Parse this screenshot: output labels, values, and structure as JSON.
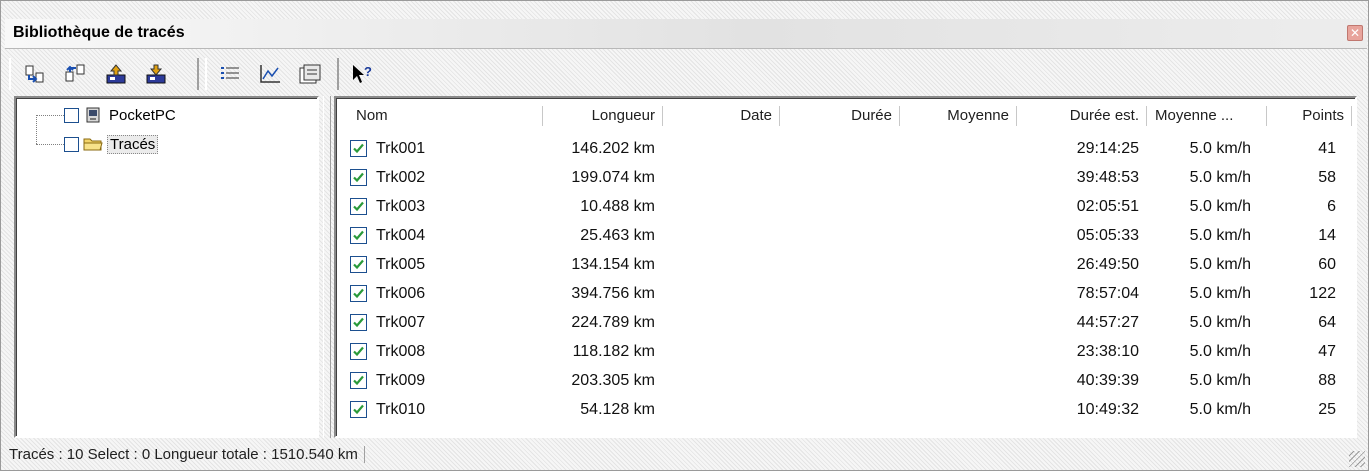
{
  "window": {
    "title": "Bibliothèque de tracés",
    "close_glyph": "✕"
  },
  "toolbar": {
    "buttons": [
      {
        "icon": "move-down-icon"
      },
      {
        "icon": "move-up-icon"
      },
      {
        "icon": "upload-icon"
      },
      {
        "icon": "download-icon"
      },
      {
        "icon": "list-view-icon"
      },
      {
        "icon": "chart-icon"
      },
      {
        "icon": "properties-icon"
      },
      {
        "icon": "help-pointer-icon"
      }
    ]
  },
  "tree": {
    "items": [
      {
        "label": "PocketPC",
        "icon": "device-icon"
      },
      {
        "label": "Tracés",
        "icon": "folder-icon"
      }
    ]
  },
  "list": {
    "columns": [
      "Nom",
      "Longueur",
      "Date",
      "Durée",
      "Moyenne",
      "Durée est.",
      "Moyenne ...",
      "Points"
    ],
    "rows": [
      {
        "name": "Trk001",
        "length": "146.202 km",
        "date": "",
        "duration": "",
        "average": "",
        "est_duration": "29:14:25",
        "est_average": "5.0 km/h",
        "points": "41",
        "checked": true
      },
      {
        "name": "Trk002",
        "length": "199.074 km",
        "date": "",
        "duration": "",
        "average": "",
        "est_duration": "39:48:53",
        "est_average": "5.0 km/h",
        "points": "58",
        "checked": true
      },
      {
        "name": "Trk003",
        "length": "10.488 km",
        "date": "",
        "duration": "",
        "average": "",
        "est_duration": "02:05:51",
        "est_average": "5.0 km/h",
        "points": "6",
        "checked": true
      },
      {
        "name": "Trk004",
        "length": "25.463 km",
        "date": "",
        "duration": "",
        "average": "",
        "est_duration": "05:05:33",
        "est_average": "5.0 km/h",
        "points": "14",
        "checked": true
      },
      {
        "name": "Trk005",
        "length": "134.154 km",
        "date": "",
        "duration": "",
        "average": "",
        "est_duration": "26:49:50",
        "est_average": "5.0 km/h",
        "points": "60",
        "checked": true
      },
      {
        "name": "Trk006",
        "length": "394.756 km",
        "date": "",
        "duration": "",
        "average": "",
        "est_duration": "78:57:04",
        "est_average": "5.0 km/h",
        "points": "122",
        "checked": true
      },
      {
        "name": "Trk007",
        "length": "224.789 km",
        "date": "",
        "duration": "",
        "average": "",
        "est_duration": "44:57:27",
        "est_average": "5.0 km/h",
        "points": "64",
        "checked": true
      },
      {
        "name": "Trk008",
        "length": "118.182 km",
        "date": "",
        "duration": "",
        "average": "",
        "est_duration": "23:38:10",
        "est_average": "5.0 km/h",
        "points": "47",
        "checked": true
      },
      {
        "name": "Trk009",
        "length": "203.305 km",
        "date": "",
        "duration": "",
        "average": "",
        "est_duration": "40:39:39",
        "est_average": "5.0 km/h",
        "points": "88",
        "checked": true
      },
      {
        "name": "Trk010",
        "length": "54.128 km",
        "date": "",
        "duration": "",
        "average": "",
        "est_duration": "10:49:32",
        "est_average": "5.0 km/h",
        "points": "25",
        "checked": true
      }
    ]
  },
  "statusbar": {
    "text": "Tracés : 10 Select : 0 Longueur totale : 1510.540 km"
  },
  "colors": {
    "checkbox_border": "#1c4f8f",
    "checkmark": "#2a9a3a",
    "close_button": "#e8a49c"
  }
}
